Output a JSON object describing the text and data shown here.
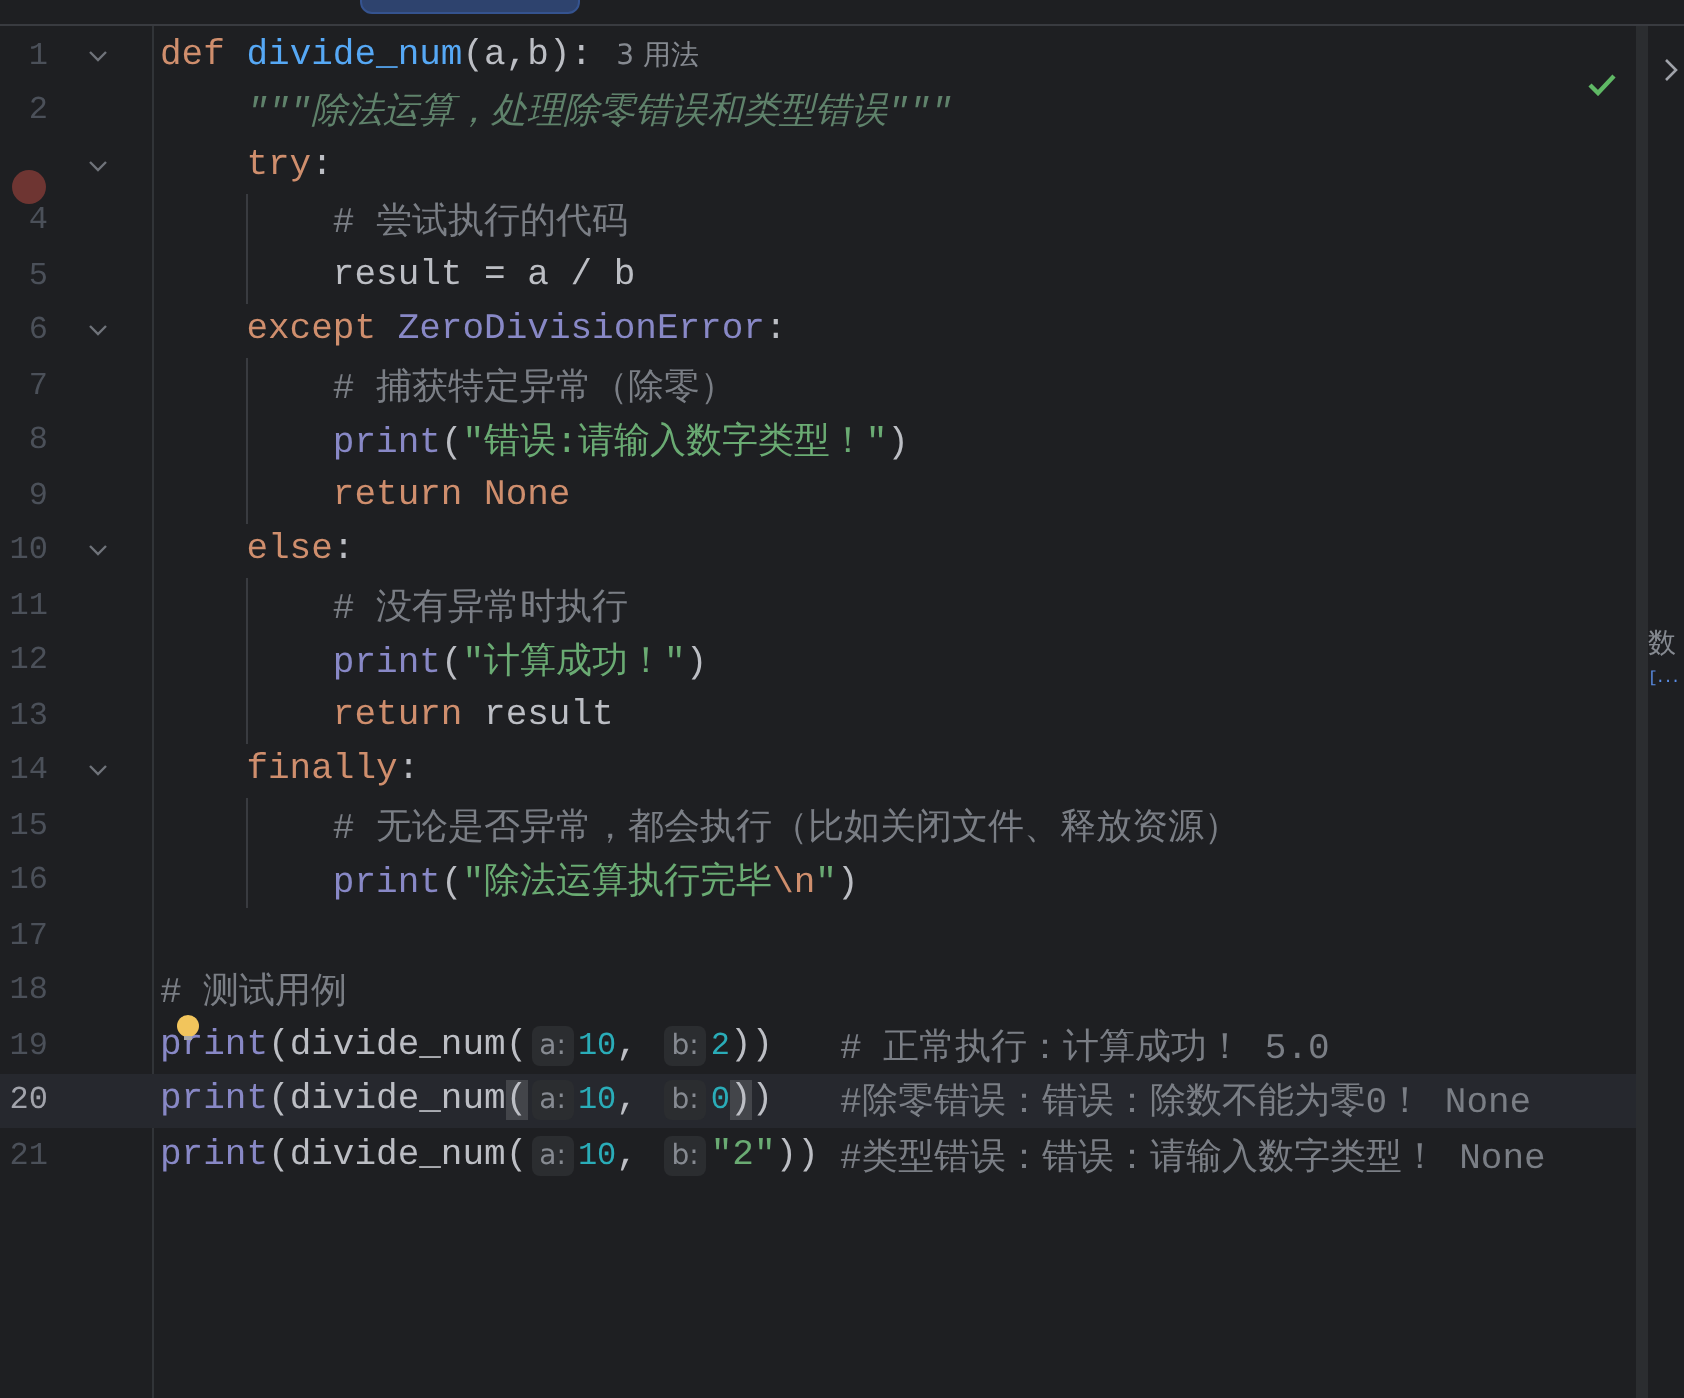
{
  "inspection_passed": true,
  "lines": [
    {
      "number": "1",
      "fold": true,
      "breakpoint": false,
      "current": false,
      "bulb": false,
      "tokens": [
        {
          "kind": "kw",
          "text": "def "
        },
        {
          "kind": "fn",
          "text": "divide_num"
        },
        {
          "kind": "p",
          "text": "(a,b):"
        },
        {
          "kind": "usage",
          "text": "3 用法"
        }
      ]
    },
    {
      "number": "2",
      "fold": false,
      "breakpoint": false,
      "current": false,
      "bulb": false,
      "tokens": [
        {
          "kind": "doc",
          "text": "    \"\"\"除法运算，处理除零错误和类型错误\"\"\""
        }
      ]
    },
    {
      "fold": true,
      "breakpoint": true,
      "current": false,
      "bulb": false,
      "tokens": [
        {
          "kind": "kw",
          "text": "    try"
        },
        {
          "kind": "p",
          "text": ":"
        }
      ]
    },
    {
      "number": "4",
      "fold": false,
      "breakpoint": false,
      "current": false,
      "bulb": false,
      "tokens": [
        {
          "kind": "cmt",
          "text": "        # 尝试执行的代码"
        }
      ]
    },
    {
      "number": "5",
      "fold": false,
      "breakpoint": false,
      "current": false,
      "bulb": false,
      "tokens": [
        {
          "kind": "p",
          "text": "        result = a / b"
        }
      ]
    },
    {
      "number": "6",
      "fold": true,
      "breakpoint": false,
      "current": false,
      "bulb": false,
      "tokens": [
        {
          "kind": "kw",
          "text": "    except "
        },
        {
          "kind": "cls",
          "text": "ZeroDivisionError"
        },
        {
          "kind": "p",
          "text": ":"
        }
      ]
    },
    {
      "number": "7",
      "fold": false,
      "breakpoint": false,
      "current": false,
      "bulb": false,
      "tokens": [
        {
          "kind": "cmt",
          "text": "        # 捕获特定异常（除零）"
        }
      ]
    },
    {
      "number": "8",
      "fold": false,
      "breakpoint": false,
      "current": false,
      "bulb": false,
      "tokens": [
        {
          "kind": "bi",
          "text": "        print"
        },
        {
          "kind": "p",
          "text": "("
        },
        {
          "kind": "str",
          "text": "\"错误:请输入数字类型！\""
        },
        {
          "kind": "p",
          "text": ")"
        }
      ]
    },
    {
      "number": "9",
      "fold": false,
      "breakpoint": false,
      "current": false,
      "bulb": false,
      "tokens": [
        {
          "kind": "kw",
          "text": "        return None"
        }
      ]
    },
    {
      "number": "10",
      "fold": true,
      "breakpoint": false,
      "current": false,
      "bulb": false,
      "tokens": [
        {
          "kind": "kw",
          "text": "    else"
        },
        {
          "kind": "p",
          "text": ":"
        }
      ]
    },
    {
      "number": "11",
      "fold": false,
      "breakpoint": false,
      "current": false,
      "bulb": false,
      "tokens": [
        {
          "kind": "cmt",
          "text": "        # 没有异常时执行"
        }
      ]
    },
    {
      "number": "12",
      "fold": false,
      "breakpoint": false,
      "current": false,
      "bulb": false,
      "tokens": [
        {
          "kind": "bi",
          "text": "        print"
        },
        {
          "kind": "p",
          "text": "("
        },
        {
          "kind": "str",
          "text": "\"计算成功！\""
        },
        {
          "kind": "p",
          "text": ")"
        }
      ]
    },
    {
      "number": "13",
      "fold": false,
      "breakpoint": false,
      "current": false,
      "bulb": false,
      "tokens": [
        {
          "kind": "kw",
          "text": "        return "
        },
        {
          "kind": "p",
          "text": "result"
        }
      ]
    },
    {
      "number": "14",
      "fold": true,
      "breakpoint": false,
      "current": false,
      "bulb": false,
      "tokens": [
        {
          "kind": "kw",
          "text": "    finally"
        },
        {
          "kind": "p",
          "text": ":"
        }
      ]
    },
    {
      "number": "15",
      "fold": false,
      "breakpoint": false,
      "current": false,
      "bulb": false,
      "tokens": [
        {
          "kind": "cmt",
          "text": "        # 无论是否异常，都会执行（比如关闭文件、释放资源）"
        }
      ]
    },
    {
      "number": "16",
      "fold": false,
      "breakpoint": false,
      "current": false,
      "bulb": false,
      "tokens": [
        {
          "kind": "bi",
          "text": "        print"
        },
        {
          "kind": "p",
          "text": "("
        },
        {
          "kind": "str",
          "text": "\"除法运算执行完毕"
        },
        {
          "kind": "esc",
          "text": "\\n"
        },
        {
          "kind": "str",
          "text": "\""
        },
        {
          "kind": "p",
          "text": ")"
        }
      ]
    },
    {
      "number": "17",
      "fold": false,
      "breakpoint": false,
      "current": false,
      "bulb": false
    },
    {
      "number": "18",
      "fold": false,
      "breakpoint": false,
      "current": false,
      "bulb": false,
      "tokens": [
        {
          "kind": "cmt",
          "text": "# 测试用例"
        }
      ]
    },
    {
      "number": "19",
      "fold": false,
      "breakpoint": false,
      "current": false,
      "bulb": true,
      "tokens": [
        {
          "kind": "bi",
          "text": "print"
        },
        {
          "kind": "p",
          "text": "(divide_num("
        },
        {
          "kind": "hint",
          "text": "a:"
        },
        {
          "kind": "num",
          "text": "10"
        },
        {
          "kind": "p",
          "text": ", "
        },
        {
          "kind": "hint",
          "text": "b:"
        },
        {
          "kind": "num",
          "text": "2"
        },
        {
          "kind": "p",
          "text": "))"
        },
        {
          "kind": "trail",
          "text": "# 正常执行：计算成功！ 5.0"
        }
      ]
    },
    {
      "number": "20",
      "fold": false,
      "breakpoint": false,
      "current": true,
      "bulb": false,
      "tokens": [
        {
          "kind": "bi",
          "text": "print"
        },
        {
          "kind": "p",
          "text": "(divide_num"
        },
        {
          "kind": "match",
          "text": "("
        },
        {
          "kind": "hint",
          "text": "a:"
        },
        {
          "kind": "num",
          "text": "10"
        },
        {
          "kind": "p",
          "text": ", "
        },
        {
          "kind": "hint",
          "text": "b:"
        },
        {
          "kind": "num",
          "text": "0"
        },
        {
          "kind": "match",
          "text": ")"
        },
        {
          "kind": "p",
          "text": ")"
        },
        {
          "kind": "trail",
          "text": "#除零错误：错误：除数不能为零0！ None"
        }
      ]
    },
    {
      "number": "21",
      "fold": false,
      "breakpoint": false,
      "current": false,
      "bulb": false,
      "tokens": [
        {
          "kind": "bi",
          "text": "print"
        },
        {
          "kind": "p",
          "text": "(divide_num("
        },
        {
          "kind": "hint",
          "text": "a:"
        },
        {
          "kind": "num",
          "text": "10"
        },
        {
          "kind": "p",
          "text": ", "
        },
        {
          "kind": "hint",
          "text": "b:"
        },
        {
          "kind": "str",
          "text": "\"2\""
        },
        {
          "kind": "p",
          "text": "))"
        },
        {
          "kind": "trail",
          "text": "#类型错误：错误：请输入数字类型！ None"
        }
      ]
    }
  ],
  "side_panel": {
    "texts": [
      {
        "kind": "label",
        "text": "数"
      },
      {
        "kind": "link",
        "text": "[..."
      }
    ]
  }
}
